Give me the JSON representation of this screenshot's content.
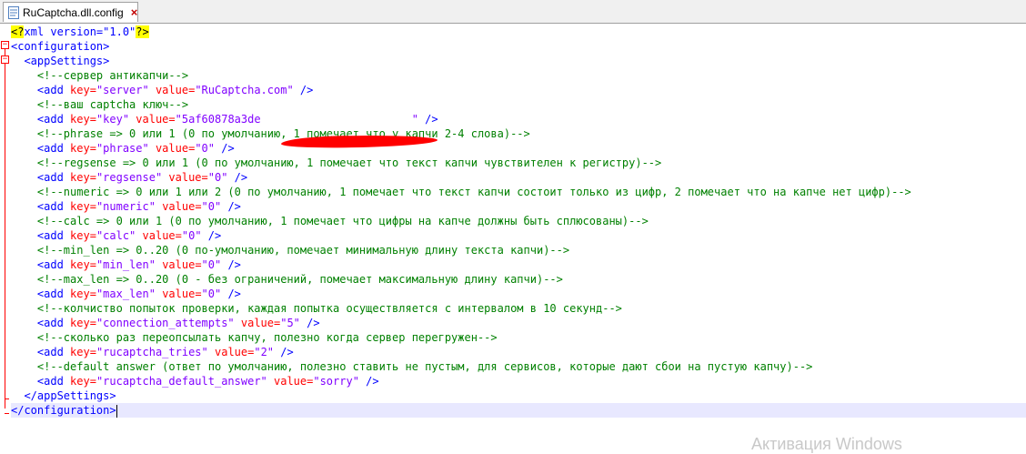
{
  "tab": {
    "filename": "RuCaptcha.dll.config",
    "close_glyph": "×"
  },
  "code": {
    "pi_open": "<?",
    "pi_body": "xml version=\"1.0\"",
    "pi_close": "?>",
    "l2": "<configuration>",
    "l3": "  <appSettings>",
    "c4": "    <!--сервер антикапчи-->",
    "a5": "    <add ",
    "k5": "key=",
    "v5a": "\"server\"",
    "k5b": " value=",
    "v5b": "\"RuCaptcha.com\"",
    "e5": " />",
    "c6": "    <!--ваш captcha ключ-->",
    "a7": "    <add ",
    "k7": "key=",
    "v7a": "\"key\"",
    "k7b": " value=",
    "v7b": "\"5af60878a3de",
    "v7c": "                       \"",
    "e7": " />",
    "c8": "    <!--phrase => 0 или 1 (0 по умолчанию, 1 помечает что у капчи 2-4 слова)-->",
    "a9": "    <add ",
    "k9": "key=",
    "v9a": "\"phrase\"",
    "k9b": " value=",
    "v9b": "\"0\"",
    "e9": " />",
    "c10": "    <!--regsense => 0 или 1 (0 по умолчанию, 1 помечает что текст капчи чувствителен к регистру)-->",
    "a11": "    <add ",
    "k11": "key=",
    "v11a": "\"regsense\"",
    "k11b": " value=",
    "v11b": "\"0\"",
    "e11": " />",
    "c12": "    <!--numeric => 0 или 1 или 2 (0 по умолчанию, 1 помечает что текст капчи состоит только из цифр, 2 помечает что на капче нет цифр)-->",
    "a13": "    <add ",
    "k13": "key=",
    "v13a": "\"numeric\"",
    "k13b": " value=",
    "v13b": "\"0\"",
    "e13": " />",
    "c14": "    <!--calc => 0 или 1 (0 по умолчанию, 1 помечает что цифры на капче должны быть сплюсованы)-->",
    "a15": "    <add ",
    "k15": "key=",
    "v15a": "\"calc\"",
    "k15b": " value=",
    "v15b": "\"0\"",
    "e15": " />",
    "c16": "    <!--min_len => 0..20 (0 по-умолчанию, помечает минимальную длину текста капчи)-->",
    "a17": "    <add ",
    "k17": "key=",
    "v17a": "\"min_len\"",
    "k17b": " value=",
    "v17b": "\"0\"",
    "e17": " />",
    "c18": "    <!--max_len => 0..20 (0 - без ограничений, помечает максимальную длину капчи)-->",
    "a19": "    <add ",
    "k19": "key=",
    "v19a": "\"max_len\"",
    "k19b": " value=",
    "v19b": "\"0\"",
    "e19": " />",
    "c20": "    <!--колчиство попыток проверки, каждая попытка осуществляется с интервалом в 10 секунд-->",
    "a21": "    <add ",
    "k21": "key=",
    "v21a": "\"connection_attempts\"",
    "k21b": " value=",
    "v21b": "\"5\"",
    "e21": " />",
    "c22": "    <!--сколько раз переопсылать капчу, полезно когда сервер перегружен-->",
    "a23": "    <add ",
    "k23": "key=",
    "v23a": "\"rucaptcha_tries\"",
    "k23b": " value=",
    "v23b": "\"2\"",
    "e23": " />",
    "c24": "    <!--default answer (ответ по умолчанию, полезно ставить не пустым, для сервисов, которые дают сбои на пустую капчу)-->",
    "a25": "    <add ",
    "k25": "key=",
    "v25a": "\"rucaptcha_default_answer\"",
    "k25b": " value=",
    "v25b": "\"sorry\"",
    "e25": " />",
    "l26": "  </appSettings>",
    "l27": "</configuration>"
  },
  "colors": {
    "tag": "#0000ff",
    "attr": "#ff0000",
    "value": "#8000ff",
    "comment": "#008000",
    "current_line": "#e8e8ff"
  },
  "watermark": "Активация Windows"
}
